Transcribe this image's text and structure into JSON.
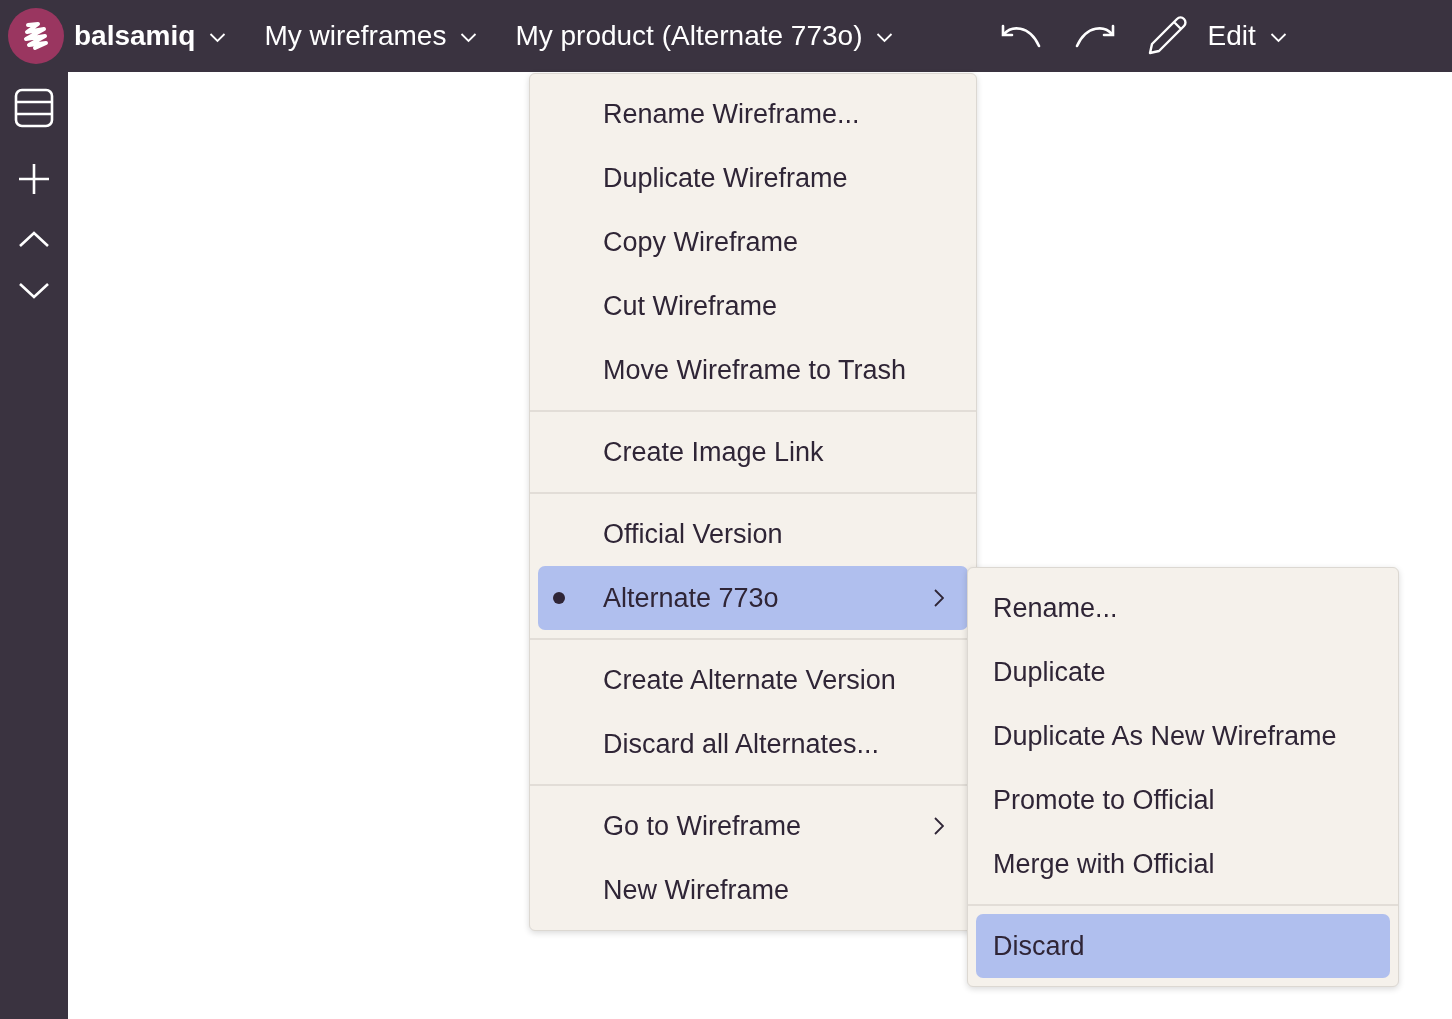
{
  "top_bar": {
    "logo_text": "balsamiq",
    "project": "My wireframes",
    "wireframe": "My product (Alternate 773o)",
    "mode": "Edit"
  },
  "menu": {
    "groups": [
      {
        "items": [
          {
            "label": "Rename Wireframe...",
            "selected": false,
            "current": false,
            "has_submenu": false
          },
          {
            "label": "Duplicate Wireframe",
            "selected": false,
            "current": false,
            "has_submenu": false
          },
          {
            "label": "Copy Wireframe",
            "selected": false,
            "current": false,
            "has_submenu": false
          },
          {
            "label": "Cut Wireframe",
            "selected": false,
            "current": false,
            "has_submenu": false
          },
          {
            "label": "Move Wireframe to Trash",
            "selected": false,
            "current": false,
            "has_submenu": false
          }
        ]
      },
      {
        "items": [
          {
            "label": "Create Image Link",
            "selected": false,
            "current": false,
            "has_submenu": false
          }
        ]
      },
      {
        "items": [
          {
            "label": "Official Version",
            "selected": false,
            "current": false,
            "has_submenu": false
          },
          {
            "label": "Alternate 773o",
            "selected": true,
            "current": true,
            "has_submenu": true
          }
        ]
      },
      {
        "items": [
          {
            "label": "Create Alternate Version",
            "selected": false,
            "current": false,
            "has_submenu": false
          },
          {
            "label": "Discard all Alternates...",
            "selected": false,
            "current": false,
            "has_submenu": false
          }
        ]
      },
      {
        "items": [
          {
            "label": "Go to Wireframe",
            "selected": false,
            "current": false,
            "has_submenu": true
          },
          {
            "label": "New Wireframe",
            "selected": false,
            "current": false,
            "has_submenu": false
          }
        ]
      }
    ]
  },
  "submenu": {
    "groups": [
      {
        "items": [
          {
            "label": "Rename...",
            "selected": false
          },
          {
            "label": "Duplicate",
            "selected": false
          },
          {
            "label": "Duplicate As New Wireframe",
            "selected": false
          },
          {
            "label": "Promote to Official",
            "selected": false
          },
          {
            "label": "Merge with Official",
            "selected": false
          }
        ]
      },
      {
        "items": [
          {
            "label": "Discard",
            "selected": true
          }
        ]
      }
    ]
  }
}
